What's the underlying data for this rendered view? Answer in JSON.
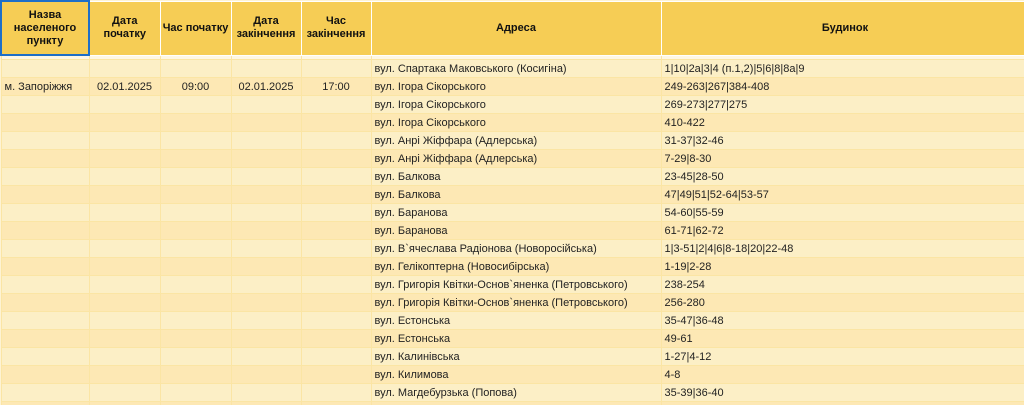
{
  "headers": {
    "settlement": "Назва населеного пункту",
    "start_date": "Дата початку",
    "start_time": "Час початку",
    "end_date": "Дата закінчення",
    "end_time": "Час закінчення",
    "address": "Адреса",
    "building": "Будинок"
  },
  "info": {
    "settlement": "м. Запоріжжя",
    "start_date": "02.01.2025",
    "start_time": "09:00",
    "end_date": "02.01.2025",
    "end_time": "17:00"
  },
  "rows": [
    {
      "address": "вул. Спартака Маковського (Косигіна)",
      "building": "1|10|2а|3|4 (п.1,2)|5|6|8|8а|9"
    },
    {
      "address": "вул. Ігора Сікорського",
      "building": "249-263|267|384-408"
    },
    {
      "address": "вул. Ігора Сікорського",
      "building": "269-273|277|275"
    },
    {
      "address": "вул. Ігора Сікорського",
      "building": "410-422"
    },
    {
      "address": "вул. Анрі Жіффара (Адлерська)",
      "building": "31-37|32-46"
    },
    {
      "address": "вул. Анрі Жіффара (Адлерська)",
      "building": "7-29|8-30"
    },
    {
      "address": "вул. Балкова",
      "building": "23-45|28-50"
    },
    {
      "address": "вул. Балкова",
      "building": "47|49|51|52-64|53-57"
    },
    {
      "address": "вул. Баранова",
      "building": "54-60|55-59"
    },
    {
      "address": "вул. Баранова",
      "building": "61-71|62-72"
    },
    {
      "address": "вул. В`ячеслава Радіонова (Новоросійська)",
      "building": "1|3-51|2|4|6|8-18|20|22-48"
    },
    {
      "address": "вул. Гелікоптерна (Новосибірська)",
      "building": "1-19|2-28"
    },
    {
      "address": "вул. Григорія Квітки-Основ`яненка (Петровського)",
      "building": "238-254"
    },
    {
      "address": "вул. Григорія Квітки-Основ`яненка (Петровського)",
      "building": "256-280"
    },
    {
      "address": "вул. Естонська",
      "building": "35-47|36-48"
    },
    {
      "address": "вул. Естонська",
      "building": "49-61"
    },
    {
      "address": "вул. Калинівська",
      "building": "1-27|4-12"
    },
    {
      "address": "вул. Килимова",
      "building": "4-8"
    },
    {
      "address": "вул. Магдебурзька (Попова)",
      "building": "35-39|36-40"
    },
    {
      "address": "",
      "building": ""
    }
  ]
}
